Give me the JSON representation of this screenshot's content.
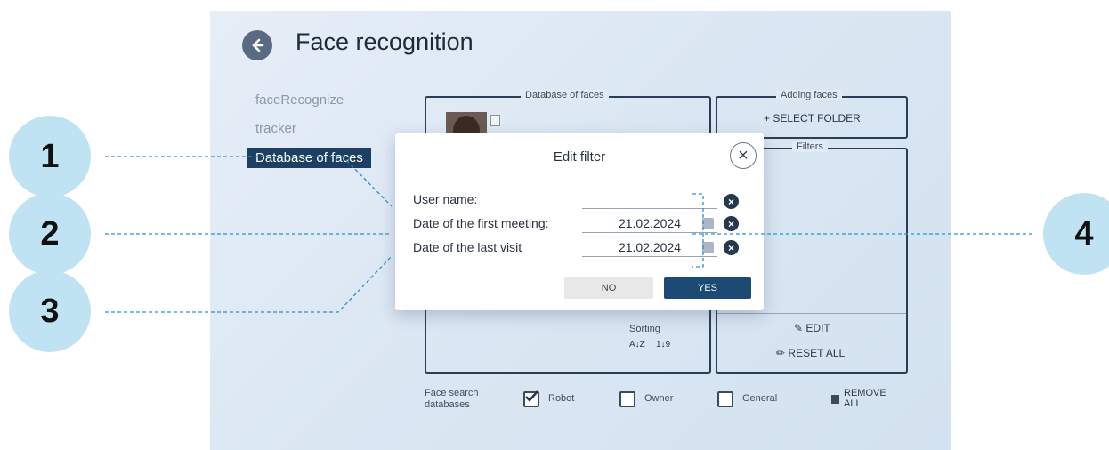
{
  "header": {
    "title": "Face recognition"
  },
  "sidebar": {
    "items": [
      {
        "label": "faceRecognize"
      },
      {
        "label": "tracker"
      },
      {
        "label": "Database of faces"
      }
    ]
  },
  "database_panel": {
    "legend": "Database of faces",
    "sorting_label": "Sorting",
    "sort_az_glyph": "A↓Z",
    "sort_19_glyph": "1↓9"
  },
  "adding_panel": {
    "legend": "Adding faces",
    "select_folder_label": "+ SELECT FOLDER"
  },
  "filters_panel": {
    "legend": "Filters",
    "edit_label": "EDIT",
    "reset_label": "RESET ALL"
  },
  "footer": {
    "search_db_label": "Face search databases",
    "checkboxes": [
      {
        "label": "Robot",
        "checked": true
      },
      {
        "label": "Owner",
        "checked": false
      },
      {
        "label": "General",
        "checked": false
      }
    ],
    "remove_all_label": "REMOVE ALL"
  },
  "modal": {
    "title": "Edit filter",
    "fields": [
      {
        "label": "User name:",
        "value": ""
      },
      {
        "label": "Date of the first meeting:",
        "value": "21.02.2024"
      },
      {
        "label": "Date of the last visit",
        "value": "21.02.2024"
      }
    ],
    "no_label": "NO",
    "yes_label": "YES"
  },
  "annotations": [
    {
      "label": "1"
    },
    {
      "label": "2"
    },
    {
      "label": "3"
    },
    {
      "label": "4"
    }
  ],
  "colors": {
    "accent": "#1c4a74",
    "active_nav": "#1c3f63",
    "bubble": "#bfe3f2",
    "leader_line": "#2f8fc6"
  }
}
